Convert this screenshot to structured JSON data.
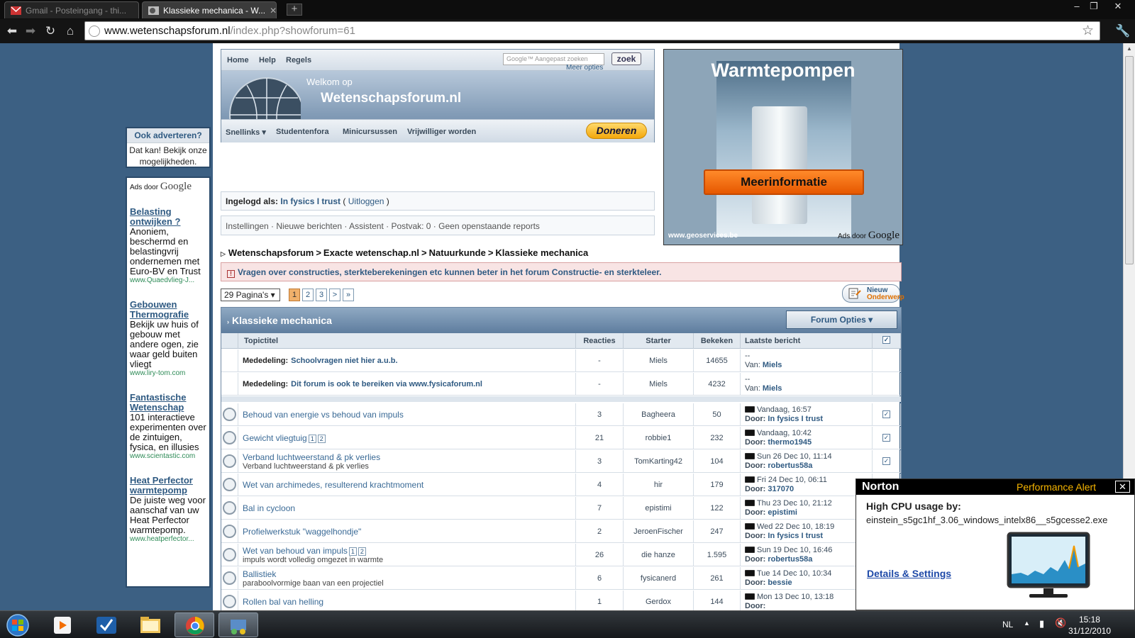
{
  "browser": {
    "tabs": [
      {
        "title": "Gmail - Posteingang - thi...",
        "active": false
      },
      {
        "title": "Klassieke mechanica - W...",
        "active": true
      }
    ],
    "url_host": "www.wetenschapsforum.nl",
    "url_path": "/index.php?showforum=61"
  },
  "left_ads": {
    "box1_title": "Ook adverteren?",
    "box1_body": "Dat kan! Bekijk onze mogelijkheden.",
    "ads_by": "Ads door",
    "google": "Google",
    "items": [
      {
        "title": "Belasting ontwijken ?",
        "desc": "Anoniem, beschermd en belastingvrij ondernemen met Euro-BV en Trust",
        "url": "www.Quaedvlieg-J..."
      },
      {
        "title": "Gebouwen Thermografie",
        "desc": "Bekijk uw huis of gebouw met andere ogen, zie waar geld buiten vliegt",
        "url": "www.liry-tom.com"
      },
      {
        "title": "Fantastische Wetenschap",
        "desc": "101 interactieve experimenten over de zintuigen, fysica, en illusies",
        "url": "www.scientastic.com"
      },
      {
        "title": "Heat Perfector warmtepomp",
        "desc": "De juiste weg voor aanschaf van uw Heat Perfector warmtepomp.",
        "url": "www.heatperfector..."
      }
    ]
  },
  "header": {
    "nav": [
      "Home",
      "Help",
      "Regels"
    ],
    "search_placeholder": "Aangepast zoeken",
    "search_brand": "Google™",
    "search_button": "zoek",
    "more_options": "Meer opties",
    "welcome": "Welkom op",
    "site_name": "Wetenschapsforum.nl",
    "subnav": [
      "Snellinks ▾",
      "Studentenfora",
      "Minicursussen",
      "Vrijwilliger worden"
    ],
    "donate": "Doneren"
  },
  "login": {
    "label": "Ingelogd als:",
    "user": "In fysics I trust",
    "logout_pre": "(",
    "logout": "Uitloggen",
    "logout_post": ")"
  },
  "userlinks": "Instellingen · Nieuwe berichten · Assistent · Postvak: 0 · Geen openstaande reports",
  "right_ad": {
    "title": "Warmtepompen",
    "button": "Meerinformatie",
    "url": "www.geoservices.be",
    "ads_by": "Ads door",
    "google": "Google"
  },
  "breadcrumb": [
    "Wetenschapsforum",
    "Exacte wetenschap.nl",
    "Natuurkunde",
    "Klassieke mechanica"
  ],
  "breadcrumb_sep": ">",
  "notice": "Vragen over constructies, sterkteberekeningen etc kunnen beter in het forum Constructie- en sterkteleer.",
  "pagination": {
    "select": "29 Pagina's ▾",
    "pages": [
      "1",
      "2",
      "3",
      ">",
      "»"
    ],
    "current": "1",
    "new_topic_line1": "Nieuw",
    "new_topic_line2": "Onderwerp"
  },
  "forum": {
    "title": "Klassieke mechanica",
    "options": "Forum Opties ▾",
    "columns": [
      "Topictitel",
      "Reacties",
      "Starter",
      "Bekeken",
      "Laatste bericht"
    ],
    "announcements": [
      {
        "prefix": "Mededeling:",
        "title": "Schoolvragen niet hier a.u.b.",
        "replies": "-",
        "starter": "Miels",
        "views": "14655",
        "last_top": "--",
        "last_by_label": "Van:",
        "last_by": "Miels"
      },
      {
        "prefix": "Mededeling:",
        "title": "Dit forum is ook te bereiken via www.fysicaforum.nl",
        "replies": "-",
        "starter": "Miels",
        "views": "4232",
        "last_top": "--",
        "last_by_label": "Van:",
        "last_by": "Miels"
      }
    ],
    "topics": [
      {
        "title": "Behoud van energie vs behoud van impuls",
        "sub": "",
        "pages": [],
        "replies": "3",
        "starter": "Bagheera",
        "views": "50",
        "date": "Vandaag, 16:57",
        "by": "In fysics I trust",
        "checked": true
      },
      {
        "title": "Gewicht vliegtuig",
        "sub": "",
        "pages": [
          "1",
          "2"
        ],
        "replies": "21",
        "starter": "robbie1",
        "views": "232",
        "date": "Vandaag, 10:42",
        "by": "thermo1945",
        "checked": true
      },
      {
        "title": "Verband luchtweerstand & pk verlies",
        "sub": "Verband luchtweerstand & pk verlies",
        "pages": [],
        "replies": "3",
        "starter": "TomKarting42",
        "views": "104",
        "date": "Sun 26 Dec 10, 11:14",
        "by": "robertus58a",
        "checked": true
      },
      {
        "title": "Wet van archimedes, resulterend krachtmoment",
        "sub": "",
        "pages": [],
        "replies": "4",
        "starter": "hir",
        "views": "179",
        "date": "Fri 24 Dec 10, 06:11",
        "by": "317070",
        "checked": false
      },
      {
        "title": "Bal in cycloon",
        "sub": "",
        "pages": [],
        "replies": "7",
        "starter": "epistimi",
        "views": "122",
        "date": "Thu 23 Dec 10, 21:12",
        "by": "epistimi",
        "checked": false
      },
      {
        "title": "Profielwerkstuk \"waggelhondje\"",
        "sub": "",
        "pages": [],
        "replies": "2",
        "starter": "JeroenFischer",
        "views": "247",
        "date": "Wed 22 Dec 10, 18:19",
        "by": "In fysics I trust",
        "checked": false
      },
      {
        "title": "Wet van behoud van impuls",
        "sub": "impuls wordt volledig omgezet in warmte",
        "pages": [
          "1",
          "2"
        ],
        "replies": "26",
        "starter": "die hanze",
        "views": "1.595",
        "date": "Sun 19 Dec 10, 16:46",
        "by": "robertus58a",
        "checked": false
      },
      {
        "title": "Ballistiek",
        "sub": "paraboolvormige baan van een projectiel",
        "pages": [],
        "replies": "6",
        "starter": "fysicanerd",
        "views": "261",
        "date": "Tue 14 Dec 10, 10:34",
        "by": "bessie",
        "checked": false
      },
      {
        "title": "Rollen bal van helling",
        "sub": "",
        "pages": [],
        "replies": "1",
        "starter": "Gerdox",
        "views": "144",
        "date": "Mon 13 Dec 10, 13:18",
        "by": "",
        "checked": false
      }
    ],
    "by_label": "Door:"
  },
  "norton": {
    "brand": "Norton",
    "alert": "Performance Alert",
    "close": "✕",
    "heading": "High CPU usage by:",
    "process": "einstein_s5gc1hf_3.06_windows_intelx86__s5gcesse2.exe",
    "link": "Details & Settings"
  },
  "taskbar": {
    "lang": "NL",
    "time": "15:18",
    "date": "31/12/2010"
  }
}
